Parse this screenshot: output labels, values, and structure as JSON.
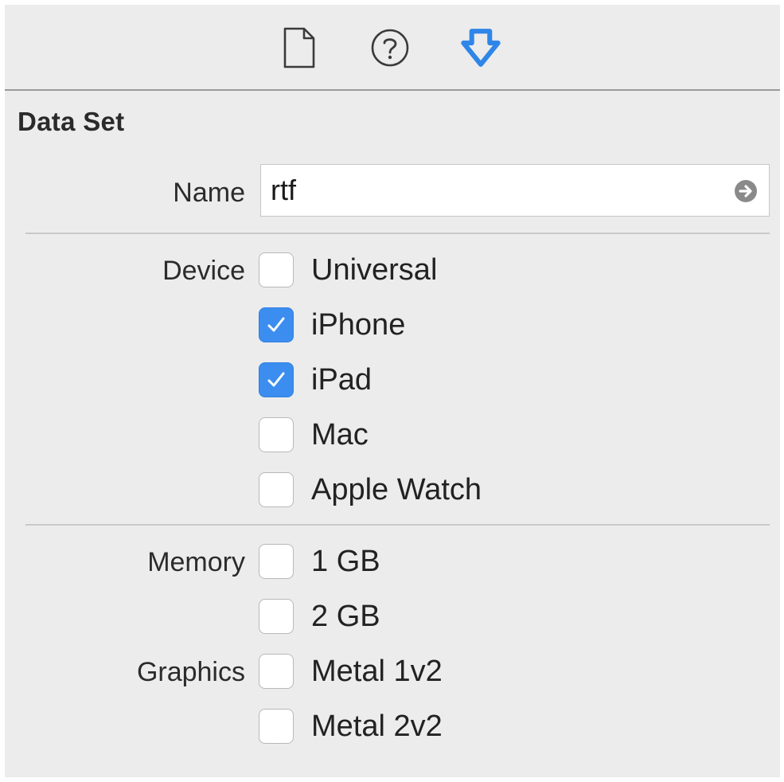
{
  "toolbar": {
    "icons": [
      {
        "name": "file-inspector-icon",
        "active": false
      },
      {
        "name": "quick-help-icon",
        "active": false
      },
      {
        "name": "attributes-inspector-icon",
        "active": true
      }
    ],
    "accent_color": "#2f86e8"
  },
  "section": {
    "title": "Data Set"
  },
  "name_field": {
    "label": "Name",
    "value": "rtf"
  },
  "device": {
    "label": "Device",
    "options": [
      {
        "label": "Universal",
        "checked": false
      },
      {
        "label": "iPhone",
        "checked": true
      },
      {
        "label": "iPad",
        "checked": true
      },
      {
        "label": "Mac",
        "checked": false
      },
      {
        "label": "Apple Watch",
        "checked": false
      }
    ]
  },
  "memory": {
    "label": "Memory",
    "options": [
      {
        "label": "1 GB",
        "checked": false
      },
      {
        "label": "2 GB",
        "checked": false
      }
    ]
  },
  "graphics": {
    "label": "Graphics",
    "options": [
      {
        "label": "Metal 1v2",
        "checked": false
      },
      {
        "label": "Metal 2v2",
        "checked": false
      }
    ]
  },
  "colors": {
    "checkbox_checked": "#3b8ef0",
    "panel_background": "#ececec"
  }
}
